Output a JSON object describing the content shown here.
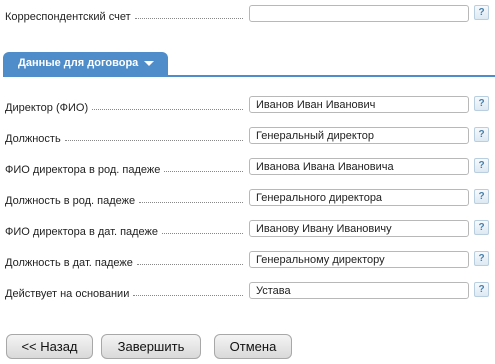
{
  "top_row": {
    "label": "Корреспондентский счет",
    "value": "",
    "help": "?"
  },
  "tab": {
    "label": "Данные для договора"
  },
  "fields": [
    {
      "label": "Директор (ФИО)",
      "value": "Иванов Иван Иванович",
      "help": "?"
    },
    {
      "label": "Должность",
      "value": "Генеральный директор",
      "help": "?"
    },
    {
      "label": "ФИО директора в род. падеже",
      "value": "Иванова Ивана Ивановича",
      "help": "?"
    },
    {
      "label": "Должность в род. падеже",
      "value": "Генерального директора",
      "help": "?"
    },
    {
      "label": "ФИО директора в дат. падеже",
      "value": "Иванову Ивану Ивановичу",
      "help": "?"
    },
    {
      "label": "Должность в дат. падеже",
      "value": "Генеральному директору",
      "help": "?"
    },
    {
      "label": "Действует на основании",
      "value": "Устава",
      "help": "?"
    }
  ],
  "buttons": {
    "back": "<< Назад",
    "finish": "Завершить",
    "cancel": "Отмена"
  }
}
